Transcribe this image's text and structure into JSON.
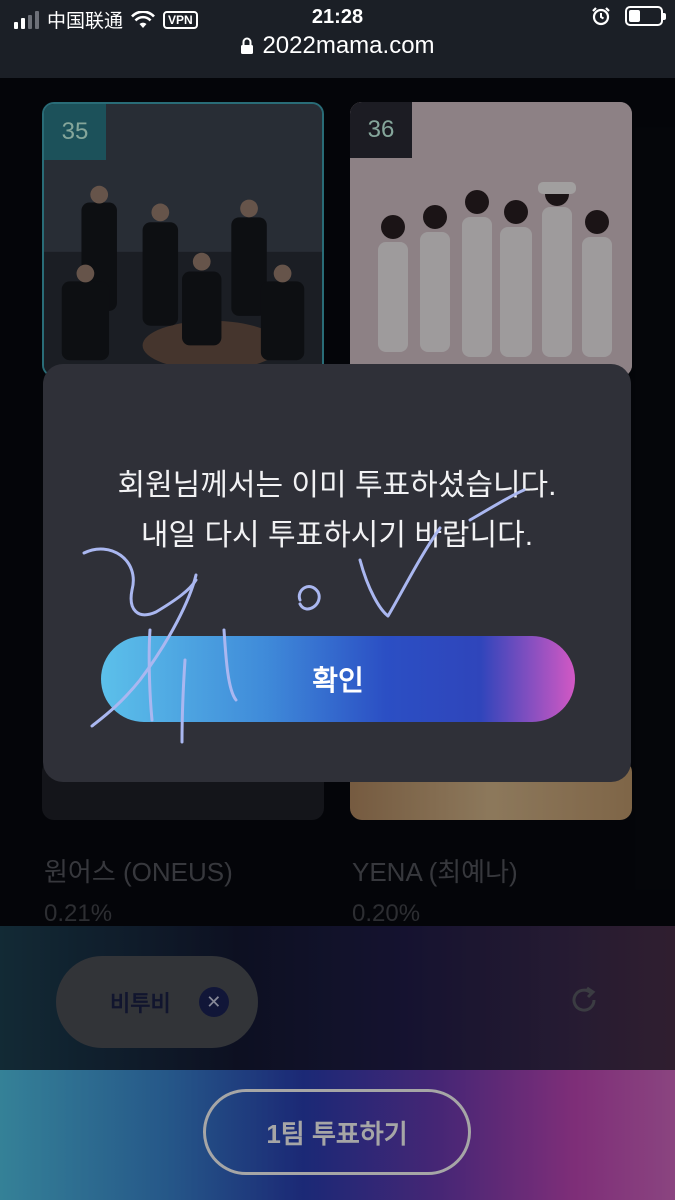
{
  "status_bar": {
    "carrier": "中国联通",
    "vpn": "VPN",
    "time": "21:28",
    "battery_level": 0.35
  },
  "browser": {
    "url": "2022mama.com"
  },
  "cards": [
    {
      "rank": "35",
      "name": "원어스 (ONEUS)",
      "percent": "0.21%"
    },
    {
      "rank": "36",
      "name": "YENA (최예나)",
      "percent": "0.20%"
    }
  ],
  "dialog": {
    "line1": "회원님께서는 이미 투표하셨습니다.",
    "line2": "내일 다시 투표하시기 바랍니다.",
    "confirm_label": "확인"
  },
  "selection": {
    "chip_label": "비투비",
    "remove_glyph": "✕"
  },
  "vote_button": {
    "label": "1팀 투표하기"
  },
  "colors": {
    "accent_cyan": "#52c7e9",
    "accent_blue": "#2a3fb5",
    "accent_pink": "#d56ac5",
    "dialog_bg": "#2f3038",
    "scribble": "#aab7f0"
  },
  "icons": [
    "lock-icon",
    "wifi-icon",
    "alarm-icon",
    "battery-icon",
    "close-icon",
    "refresh-icon"
  ]
}
